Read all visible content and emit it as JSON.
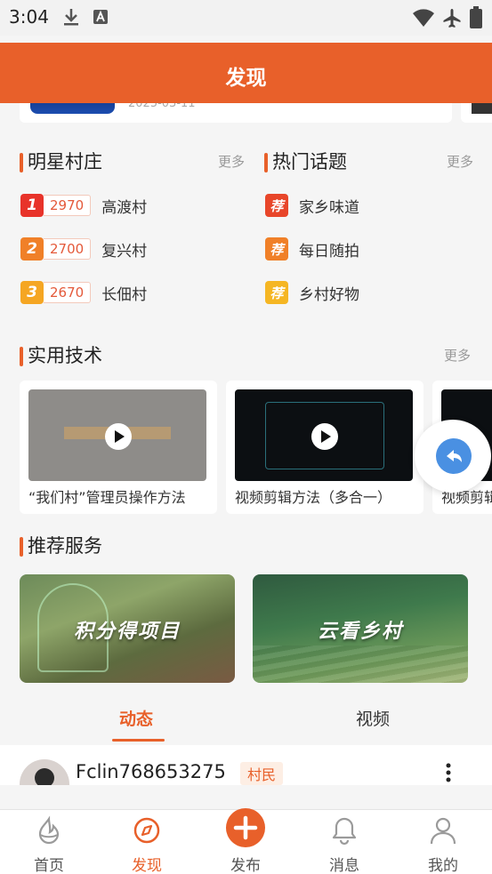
{
  "status_bar": {
    "time": "3:04",
    "icons": [
      "download-icon",
      "text-a-icon",
      "wifi-icon",
      "airplane-icon",
      "battery-icon"
    ]
  },
  "header": {
    "title": "发现"
  },
  "top_strip": {
    "date": "2025-03-11"
  },
  "star_villages": {
    "title": "明星村庄",
    "more": "更多",
    "items": [
      {
        "rank": "1",
        "score": "2970",
        "name": "高渡村",
        "color": "#e8332a"
      },
      {
        "rank": "2",
        "score": "2700",
        "name": "复兴村",
        "color": "#f08028"
      },
      {
        "rank": "3",
        "score": "2670",
        "name": "长佃村",
        "color": "#f5a623"
      }
    ]
  },
  "hot_topics": {
    "title": "热门话题",
    "more": "更多",
    "badge": "荐",
    "items": [
      {
        "name": "家乡味道",
        "color": "#e8462a"
      },
      {
        "name": "每日随拍",
        "color": "#f08028"
      },
      {
        "name": "乡村好物",
        "color": "#f5b623"
      }
    ]
  },
  "practical_tech": {
    "title": "实用技术",
    "more": "更多",
    "videos": [
      {
        "title": "“我们村”管理员操作方法",
        "thumb_text": "“我们村”管理员"
      },
      {
        "title": "视频剪辑方法（多合一）",
        "thumb_text": "视频剪辑操作方法（二）多合一"
      },
      {
        "title": "视频剪辑"
      }
    ]
  },
  "services": {
    "title": "推荐服务",
    "banners": [
      {
        "label": "积分得项目"
      },
      {
        "label": "云看乡村"
      }
    ]
  },
  "tabs": {
    "active": "动态",
    "other": "视频"
  },
  "feed": {
    "username": "Fclin768653275",
    "role": "村民"
  },
  "bottom_nav": {
    "items": [
      {
        "label": "首页",
        "icon": "home-icon"
      },
      {
        "label": "发现",
        "icon": "compass-icon",
        "active": true
      },
      {
        "label": "发布",
        "icon": "plus-icon"
      },
      {
        "label": "消息",
        "icon": "bell-icon"
      },
      {
        "label": "我的",
        "icon": "user-icon"
      }
    ]
  },
  "colors": {
    "accent": "#e8602a",
    "fab": "#4a90e2"
  }
}
